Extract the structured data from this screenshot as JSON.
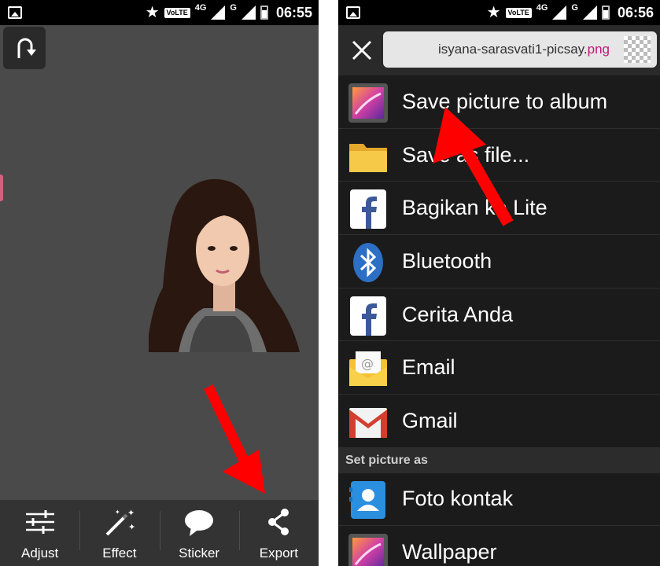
{
  "left_screen": {
    "status_bar": {
      "network_badge": "VoLTE",
      "network_type_1": "4G",
      "network_type_2": "G",
      "time": "06:55"
    },
    "toolbar": [
      {
        "label": "Adjust",
        "icon": "sliders-icon"
      },
      {
        "label": "Effect",
        "icon": "magic-wand-icon"
      },
      {
        "label": "Sticker",
        "icon": "speech-bubble-icon"
      },
      {
        "label": "Export",
        "icon": "share-icon"
      }
    ]
  },
  "right_screen": {
    "status_bar": {
      "network_badge": "VoLTE",
      "network_type_1": "4G",
      "network_type_2": "G",
      "time": "06:56"
    },
    "file": {
      "name": "isyana-sarasvati1-picsay.",
      "extension": "png"
    },
    "share_options": [
      {
        "label": "Save picture to album",
        "icon": "gallery-icon"
      },
      {
        "label": "Save as file...",
        "icon": "folder-icon"
      },
      {
        "label": "Bagikan ke Lite",
        "icon": "facebook-icon"
      },
      {
        "label": "Bluetooth",
        "icon": "bluetooth-icon"
      },
      {
        "label": "Cerita Anda",
        "icon": "facebook-icon"
      },
      {
        "label": "Email",
        "icon": "email-icon"
      },
      {
        "label": "Gmail",
        "icon": "gmail-icon"
      }
    ],
    "set_picture_section": {
      "title": "Set picture as",
      "options": [
        {
          "label": "Foto kontak",
          "icon": "contact-icon"
        },
        {
          "label": "Wallpaper",
          "icon": "gallery-icon"
        }
      ]
    }
  },
  "colors": {
    "annotation_arrow": "#ff0000",
    "file_extension": "#c2187a",
    "editor_background": "#4a4a4a",
    "menu_background": "#1b1b1b"
  }
}
